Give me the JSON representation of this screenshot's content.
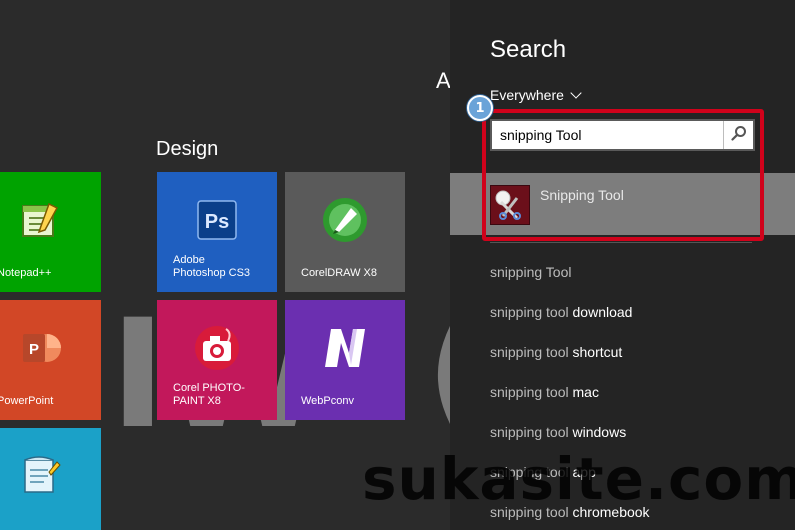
{
  "start": {
    "group_design": "Design",
    "group_next_letter": "A",
    "background_letters_left": "IW",
    "background_letters_right": "(",
    "tiles": [
      {
        "label": "Notepad++",
        "color": "#00a300",
        "icon": "notepad-plus-icon"
      },
      {
        "label": "Adobe\nPhotoshop CS3",
        "color": "#1f5fc0",
        "icon": "photoshop-icon"
      },
      {
        "label": "CorelDRAW X8",
        "color": "#5a5a5a",
        "icon": "coreldraw-icon"
      },
      {
        "label": "PowerPoint",
        "color": "#d24726",
        "icon": "powerpoint-icon"
      },
      {
        "label": "Corel PHOTO-\nPAINT X8",
        "color": "#c2185b",
        "icon": "photo-paint-icon"
      },
      {
        "label": "WebPconv",
        "color": "#6b2fb0",
        "icon": "webpconv-icon"
      },
      {
        "label": "",
        "color": "#1ba1c8",
        "icon": "notepad-icon"
      }
    ]
  },
  "search": {
    "title": "Search",
    "scope": "Everywhere",
    "query": "snipping Tool",
    "search_button_icon": "magnifier-icon",
    "top_result": {
      "label": "Snipping Tool",
      "icon": "scissors-icon"
    },
    "suggestions": [
      {
        "prefix": "snipping Tool",
        "suffix": ""
      },
      {
        "prefix": "snipping tool",
        "suffix": " download"
      },
      {
        "prefix": "snipping tool",
        "suffix": " shortcut"
      },
      {
        "prefix": "snipping tool",
        "suffix": " mac"
      },
      {
        "prefix": "snipping tool",
        "suffix": " windows"
      },
      {
        "prefix": "snipping tool",
        "suffix": " app"
      },
      {
        "prefix": "snipping tool",
        "suffix": " chromebook"
      }
    ]
  },
  "annotation": {
    "step_number": "1",
    "highlight_color": "#d0021b"
  },
  "watermark": "sukasite.com"
}
